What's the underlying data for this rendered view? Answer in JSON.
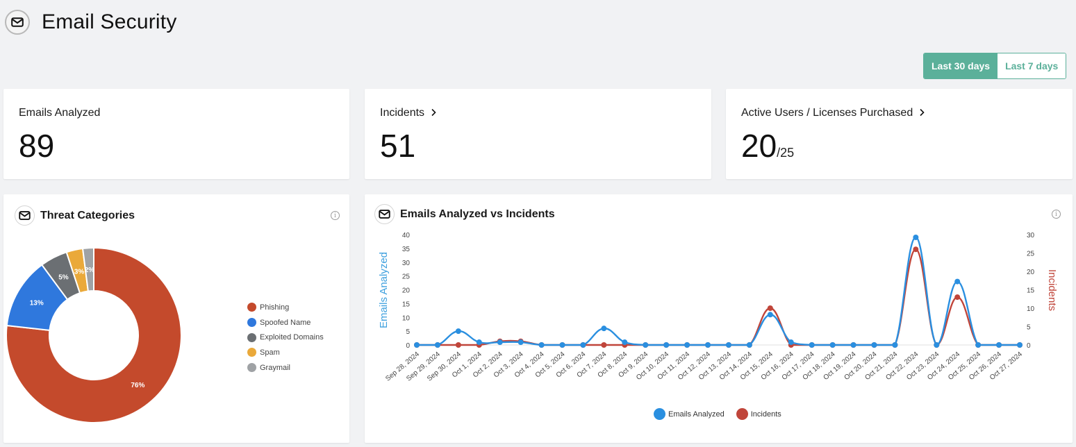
{
  "page": {
    "title": "Email Security",
    "icon": "mail-icon"
  },
  "range_toggle": {
    "options": [
      "Last 30 days",
      "Last 7 days"
    ],
    "selected": "Last 30 days"
  },
  "stats": {
    "emails_analyzed": {
      "label": "Emails Analyzed",
      "value": "89"
    },
    "incidents": {
      "label": "Incidents",
      "value": "51",
      "link_icon": "chevron-right-icon"
    },
    "active_users": {
      "label": "Active Users / Licenses Purchased",
      "value": "20",
      "sub": "/25",
      "link_icon": "chevron-right-icon"
    }
  },
  "threat_panel": {
    "title": "Threat Categories",
    "icon": "mail-icon",
    "info_icon": "info-icon"
  },
  "trend_panel": {
    "title": "Emails Analyzed vs Incidents",
    "icon": "mail-icon",
    "info_icon": "info-icon"
  },
  "chart_data": [
    {
      "type": "pie",
      "title": "Threat Categories",
      "donut": true,
      "legend_position": "right",
      "categories": [
        "Phishing",
        "Spoofed Name",
        "Exploited Domains",
        "Spam",
        "Graymail"
      ],
      "values": [
        76,
        13,
        5,
        3,
        2
      ],
      "labels": [
        "76%",
        "13%",
        "5%",
        "3%",
        "2%"
      ],
      "colors": [
        "#c44a2c",
        "#2f78dd",
        "#6b6f73",
        "#eaa93a",
        "#9fa2a5"
      ]
    },
    {
      "type": "line",
      "title": "Emails Analyzed vs Incidents",
      "smooth": true,
      "x": [
        "Sep 28, 2024",
        "Sep 29, 2024",
        "Sep 30, 2024",
        "Oct 1, 2024",
        "Oct 2, 2024",
        "Oct 3, 2024",
        "Oct 4, 2024",
        "Oct 5, 2024",
        "Oct 6, 2024",
        "Oct 7, 2024",
        "Oct 8, 2024",
        "Oct 9, 2024",
        "Oct 10, 2024",
        "Oct 11, 2024",
        "Oct 12, 2024",
        "Oct 13, 2024",
        "Oct 14, 2024",
        "Oct 15, 2024",
        "Oct 16, 2024",
        "Oct 17, 2024",
        "Oct 18, 2024",
        "Oct 19, 2024",
        "Oct 20, 2024",
        "Oct 21, 2024",
        "Oct 22, 2024",
        "Oct 23, 2024",
        "Oct 24, 2024",
        "Oct 25, 2024",
        "Oct 26, 2024",
        "Oct 27, 2024"
      ],
      "series": [
        {
          "name": "Emails Analyzed",
          "axis": "left",
          "color": "#2a8fe0",
          "values": [
            0,
            0,
            5,
            1,
            1,
            1,
            0,
            0,
            0,
            6,
            1,
            0,
            0,
            0,
            0,
            0,
            0,
            11,
            1,
            0,
            0,
            0,
            0,
            0,
            39,
            0,
            23,
            0,
            0,
            0
          ]
        },
        {
          "name": "Incidents",
          "axis": "right",
          "color": "#c0453a",
          "values": [
            0,
            0,
            0,
            0,
            1,
            1,
            0,
            0,
            0,
            0,
            0,
            0,
            0,
            0,
            0,
            0,
            0,
            10,
            0,
            0,
            0,
            0,
            0,
            0,
            26,
            0,
            13,
            0,
            0,
            0
          ]
        }
      ],
      "ylabel_left": "Emails Analyzed",
      "ylabel_right": "Incidents",
      "ylim_left": [
        0,
        40
      ],
      "yticks_left": [
        0,
        5,
        10,
        15,
        20,
        25,
        30,
        35,
        40
      ],
      "ylim_right": [
        0,
        30
      ],
      "yticks_right": [
        0,
        5,
        10,
        15,
        20,
        25,
        30
      ],
      "ylabel_left_color": "#3ea0de",
      "ylabel_right_color": "#c0453a",
      "grid": false,
      "legend_position": "bottom"
    }
  ]
}
